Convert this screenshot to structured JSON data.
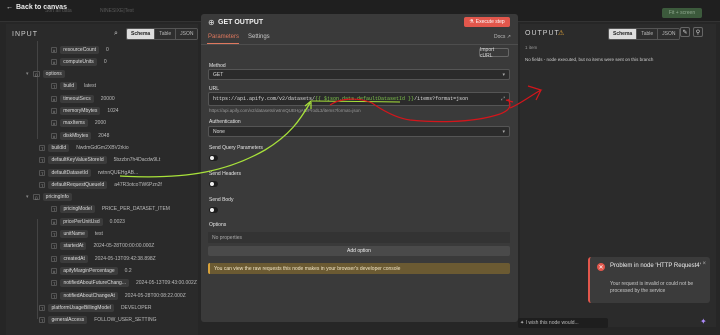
{
  "topbar": {
    "back_label": "Back to canvas",
    "faint_left": "Sort all data",
    "faint_mid": "NINESIXE|Test",
    "right_btn": "Fit + screen"
  },
  "input": {
    "title": "INPUT",
    "tabs": [
      "Schema",
      "Table",
      "JSON"
    ],
    "rows": [
      {
        "type": "#",
        "key": "resourceCount",
        "value": "0",
        "indent": 1
      },
      {
        "type": "#",
        "key": "computeUnits",
        "value": "0",
        "indent": 1
      },
      {
        "type": "{}",
        "key": "options",
        "value": "",
        "indent": 0,
        "chev": "▾"
      },
      {
        "type": "T",
        "key": "build",
        "value": "latest",
        "indent": 1
      },
      {
        "type": "#",
        "key": "timeoutSecs",
        "value": "20000",
        "indent": 1
      },
      {
        "type": "#",
        "key": "memoryMbytes",
        "value": "1024",
        "indent": 1
      },
      {
        "type": "#",
        "key": "maxItems",
        "value": "2000",
        "indent": 1
      },
      {
        "type": "#",
        "key": "diskMbytes",
        "value": "2048",
        "indent": 1
      },
      {
        "type": "T",
        "key": "buildId",
        "value": "NwdmGdGm2XBV2rkio",
        "indent": 0
      },
      {
        "type": "T",
        "key": "defaultKeyValueStoreId",
        "value": "5bzzbn7h4Dacdw9Lt",
        "indent": 0
      },
      {
        "type": "T",
        "key": "defaultDatasetId",
        "value": "rwtnnQUEHgAB...",
        "indent": 0
      },
      {
        "type": "T",
        "key": "defaultRequestQueueId",
        "value": "a47R3otcoTW6Pzn2f",
        "indent": 0
      },
      {
        "type": "{}",
        "key": "pricingInfo",
        "value": "",
        "indent": 0,
        "chev": "▾"
      },
      {
        "type": "T",
        "key": "pricingModel",
        "value": "PRICE_PER_DATASET_ITEM",
        "indent": 1
      },
      {
        "type": "#",
        "key": "pricePerUnitUsd",
        "value": "0.0023",
        "indent": 1
      },
      {
        "type": "T",
        "key": "unitName",
        "value": "test",
        "indent": 1
      },
      {
        "type": "T",
        "key": "startedAt",
        "value": "2024-05-28T00:00:00.000Z",
        "indent": 1
      },
      {
        "type": "T",
        "key": "createdAt",
        "value": "2024-05-13T09:42:38.898Z",
        "indent": 1
      },
      {
        "type": "#",
        "key": "apifyMarginPercentage",
        "value": "0.2",
        "indent": 1
      },
      {
        "type": "T",
        "key": "notifiedAboutFutureChang...",
        "value": "2024-05-13T09:43:00.002Z",
        "indent": 1
      },
      {
        "type": "T",
        "key": "notifiedAboutChangeAt",
        "value": "2024-05-28T00:08:22.000Z",
        "indent": 1
      },
      {
        "type": "T",
        "key": "platformUsageBillingModel",
        "value": "DEVELOPER",
        "indent": 0
      },
      {
        "type": "T",
        "key": "generalAccess",
        "value": "FOLLOW_USER_SETTING",
        "indent": 0
      }
    ]
  },
  "node": {
    "title": "GET OUTPUT",
    "execute_label": "Execute step",
    "tabs": [
      "Parameters",
      "Settings"
    ],
    "docs_label": "Docs",
    "import_label": "Import cURL",
    "method_label": "Method",
    "method_value": "GET",
    "url_label": "URL",
    "url_prefix": "https://api.apify.com/v2/datasets/",
    "url_expr": "{{ $json.data.defaultDatasetId }}",
    "url_suffix": "/items?format=json",
    "url_resolved": "https://api.apify.com/v2/datasets/rwtnnQUEHgAB/ProdL3/items?format=json",
    "auth_label": "Authentication",
    "auth_value": "None",
    "send_query_label": "Send Query Parameters",
    "send_headers_label": "Send Headers",
    "send_body_label": "Send Body",
    "options_label": "Options",
    "no_props": "No properties",
    "add_option": "Add option",
    "notice": "You can view the raw requests this node makes in your browser's developer console"
  },
  "output": {
    "title": "OUTPUT",
    "tabs": [
      "Schema",
      "Table",
      "JSON"
    ],
    "item_count": "1 item",
    "message": "No fields - node executed, but no items were sent on this branch",
    "wish": "I wish this node would..."
  },
  "toast": {
    "title": "Problem in node ‘HTTP Request4‘",
    "message": "Your request is invalid or could not be processed by the service"
  },
  "colors": {
    "accent": "#e2574c",
    "expression": "#7ec54b",
    "annotation_green": "#a8e23a",
    "annotation_red": "#d4151b"
  }
}
